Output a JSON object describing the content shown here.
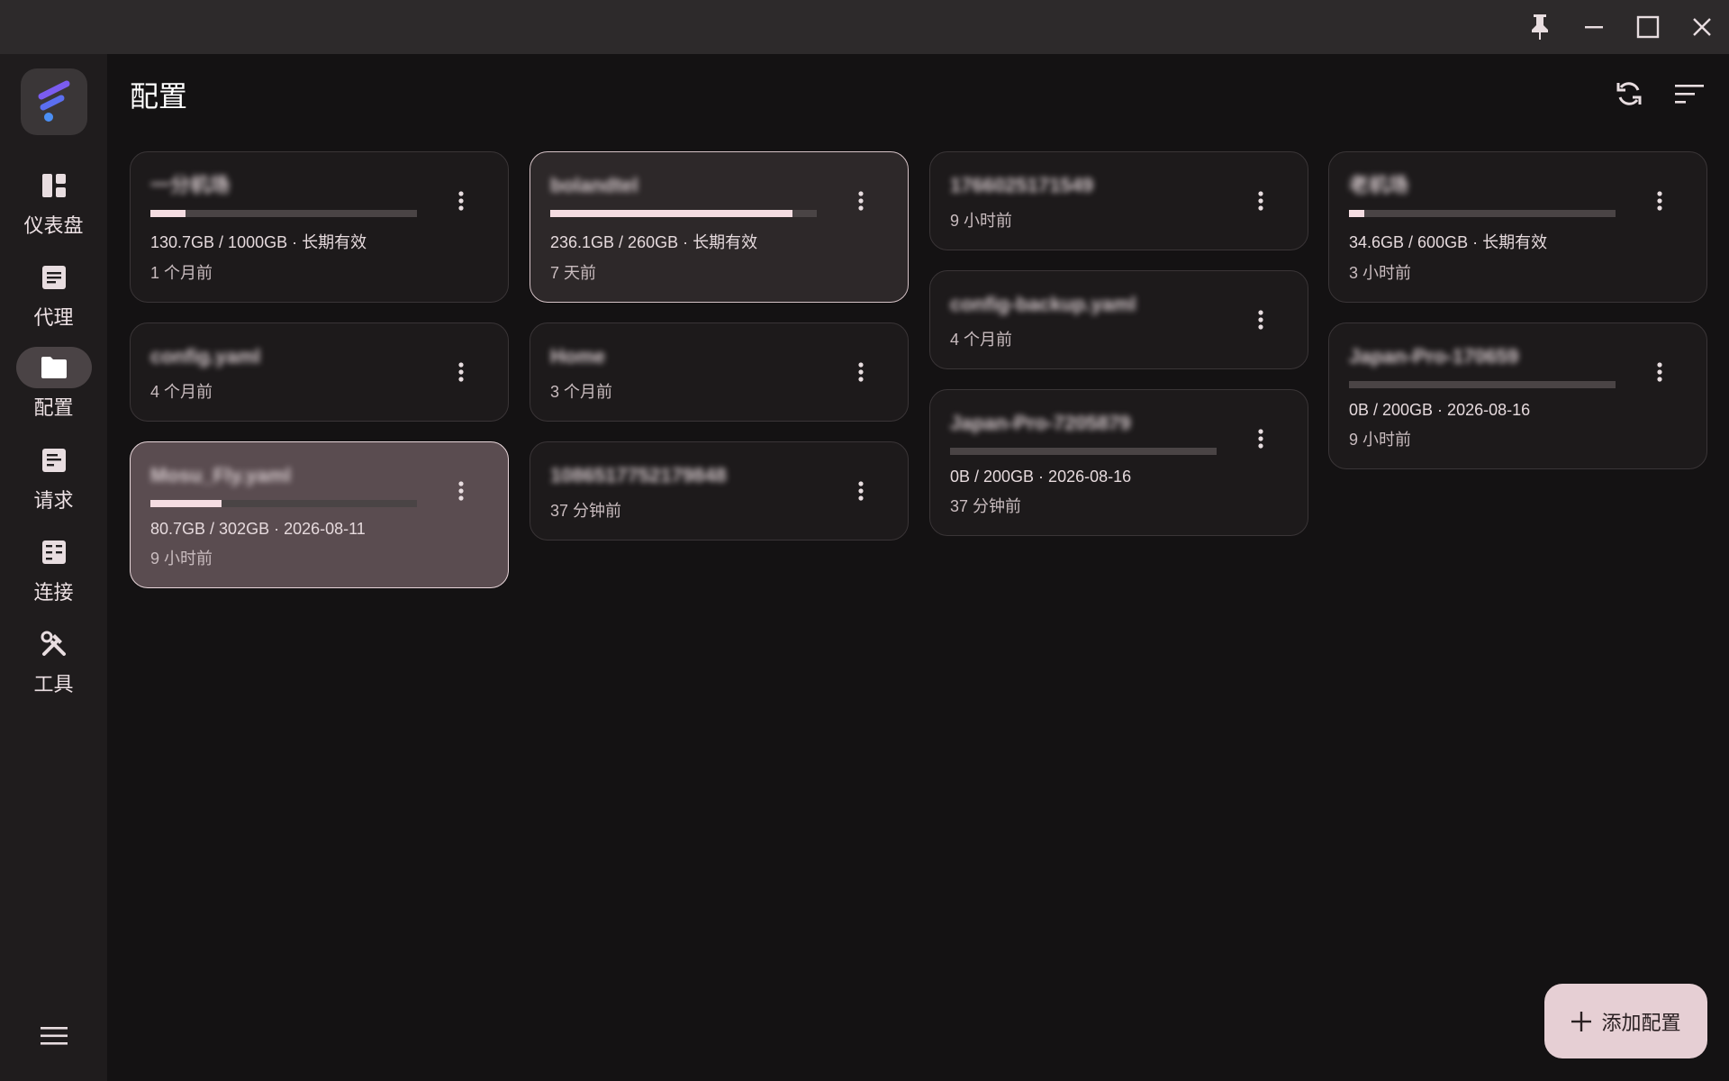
{
  "window": {
    "pin_label": "pin-icon",
    "minimize_label": "minimize-icon",
    "maximize_label": "maximize-icon",
    "close_label": "close-icon"
  },
  "sidebar": {
    "items": [
      {
        "label": "仪表盘",
        "icon": "dashboard-icon",
        "active": false
      },
      {
        "label": "代理",
        "icon": "proxy-icon",
        "active": false
      },
      {
        "label": "配置",
        "icon": "folder-icon",
        "active": true
      },
      {
        "label": "请求",
        "icon": "requests-icon",
        "active": false
      },
      {
        "label": "连接",
        "icon": "connections-icon",
        "active": false
      },
      {
        "label": "工具",
        "icon": "tools-icon",
        "active": false
      }
    ]
  },
  "header": {
    "title": "配置"
  },
  "profiles": {
    "c1": [
      {
        "name": "一分机场",
        "usage": 0.131,
        "info": "130.7GB / 1000GB · 长期有效",
        "time": "1 个月前"
      },
      {
        "name": "config.yaml",
        "time": "4 个月前"
      },
      {
        "name": "Mosu_Fly.yaml",
        "usage": 0.267,
        "info": "80.7GB / 302GB · 2026-08-11",
        "time": "9 小时前"
      }
    ],
    "c2": [
      {
        "name": "bolandtel",
        "usage": 0.908,
        "info": "236.1GB / 260GB · 长期有效",
        "time": "7 天前"
      },
      {
        "name": "Home",
        "time": "3 个月前"
      },
      {
        "name": "1086517752179848",
        "time": "37 分钟前"
      }
    ],
    "c3": [
      {
        "name": "1766025171549",
        "time": "9 小时前"
      },
      {
        "name": "config-backup.yaml",
        "time": "4 个月前"
      },
      {
        "name": "Japan-Pro-7205879",
        "usage": 0.0,
        "info": "0B / 200GB · 2026-08-16",
        "time": "37 分钟前"
      }
    ],
    "c4": [
      {
        "name": "老机场",
        "usage": 0.058,
        "info": "34.6GB / 600GB · 长期有效",
        "time": "3 小时前"
      },
      {
        "name": "Japan-Pro-170659",
        "usage": 0.0,
        "info": "0B / 200GB · 2026-08-16",
        "time": "9 小时前"
      }
    ]
  },
  "fab": {
    "label": "添加配置"
  },
  "colors": {
    "accent": "#f5dde2",
    "fab_bg": "#e6cfd4",
    "background": "#141213"
  }
}
